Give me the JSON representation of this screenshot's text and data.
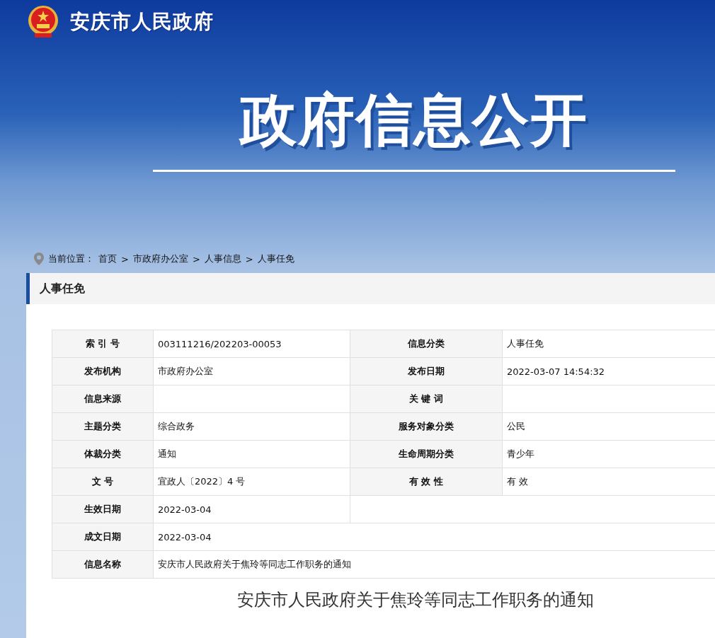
{
  "site": {
    "title": "安庆市人民政府"
  },
  "banner": {
    "title": "政府信息公开"
  },
  "breadcrumb": {
    "label": "当前位置：",
    "separator": ">",
    "items": [
      "首页",
      "市政府办公室",
      "人事信息",
      "人事任免"
    ]
  },
  "section": {
    "title": "人事任免"
  },
  "table": {
    "rows": [
      {
        "kind": "pair",
        "label": "索 引 号",
        "value": "003111216/202203-00053",
        "label_2": "信息分类",
        "value_2": "人事任免"
      },
      {
        "kind": "pair",
        "label": "发布机构",
        "value": "市政府办公室",
        "label_2": "发布日期",
        "value_2": "2022-03-07 14:54:32"
      },
      {
        "kind": "pair",
        "label": "信息来源",
        "label_2": "关 键 词"
      },
      {
        "kind": "pair",
        "label": "主题分类",
        "value": "综合政务",
        "label_2": "服务对象分类",
        "value_2": "公民"
      },
      {
        "kind": "pair",
        "label": "体裁分类",
        "value": "通知",
        "label_2": "生命周期分类",
        "value_2": "青少年"
      },
      {
        "kind": "pair",
        "label": "文 号",
        "value": "宜政人〔2022〕4 号",
        "label_2": "有 效 性",
        "value_2": "有 效"
      },
      {
        "kind": "half",
        "label": "生效日期",
        "value": "2022-03-04"
      },
      {
        "kind": "wide",
        "label": "成文日期",
        "value": "2022-03-04"
      },
      {
        "kind": "wide",
        "label": "信息名称",
        "value": "安庆市人民政府关于焦玲等同志工作职务的通知"
      }
    ]
  },
  "article": {
    "title": "安庆市人民政府关于焦玲等同志工作职务的通知"
  }
}
